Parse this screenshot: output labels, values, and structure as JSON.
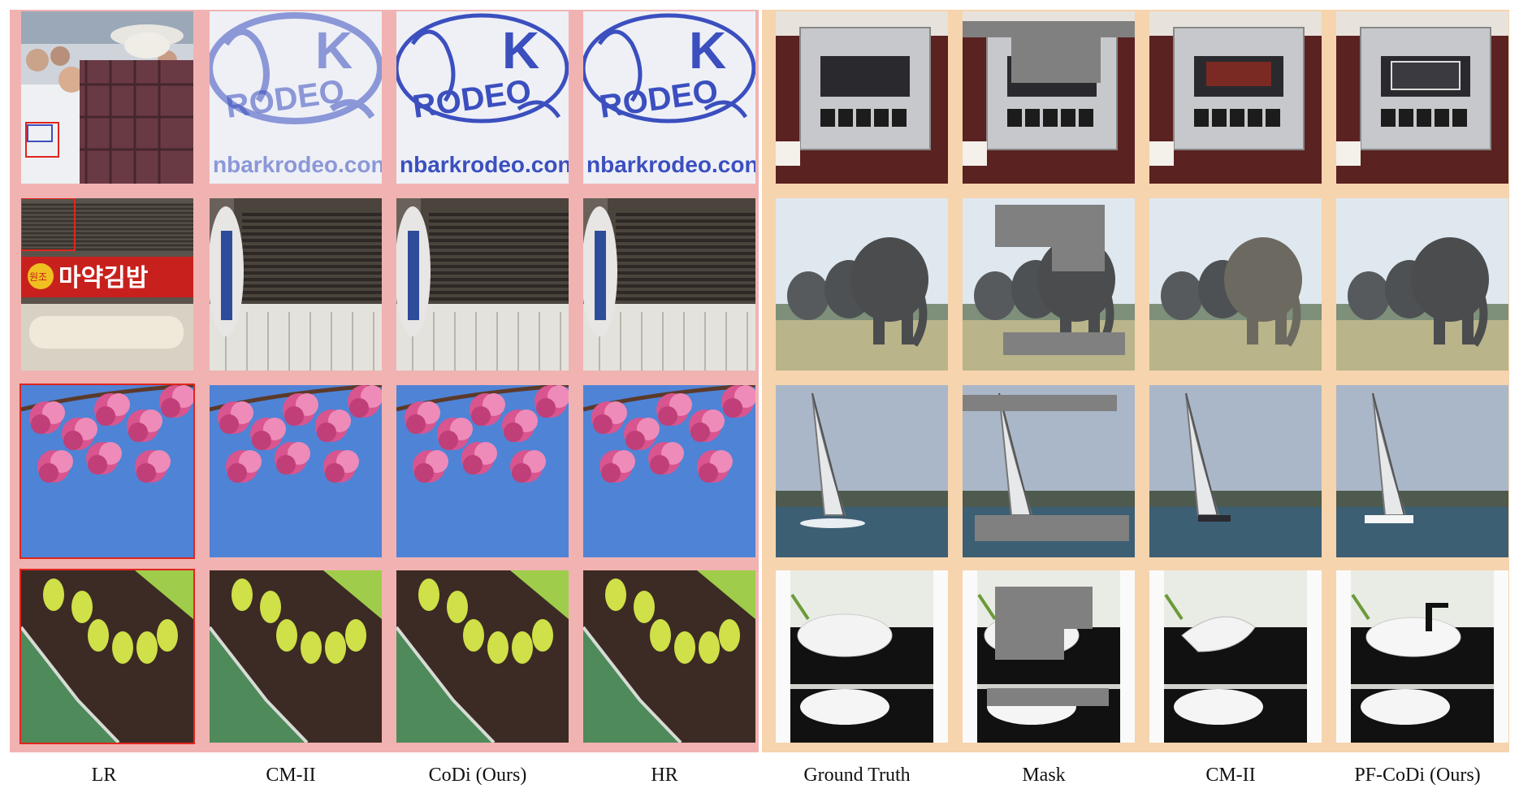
{
  "left_group": {
    "columns": [
      "LR",
      "CM-II",
      "CoDi (Ours)",
      "HR"
    ],
    "callout_text": [
      "K",
      "RODEO",
      "nbarkrodeo.con"
    ],
    "sign_text": [
      "원조",
      "마약김밥"
    ]
  },
  "right_group": {
    "columns": [
      "Ground Truth",
      "Mask",
      "CM-II",
      "PF-CoDi (Ours)"
    ]
  },
  "colors": {
    "left_background": "#f1b3b2",
    "right_background": "#f6d4ae",
    "mask_gray": "#808080",
    "crop_box": "#e0251e"
  },
  "rows": [
    {
      "left_scene": "rodeo-shirt-logo",
      "right_scene": "cassette-player"
    },
    {
      "left_scene": "storefront-vent",
      "right_scene": "elephants"
    },
    {
      "left_scene": "cherry-blossoms",
      "right_scene": "sailboat"
    },
    {
      "left_scene": "butterfly-wing",
      "right_scene": "bathroom-sink"
    }
  ]
}
